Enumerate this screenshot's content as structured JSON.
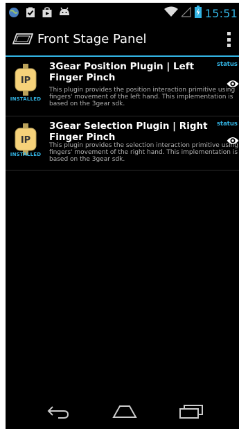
{
  "statusbar": {
    "time": "15:51",
    "icons": [
      "globe-icon",
      "clipboard-check-icon",
      "play-store-icon",
      "android-icon",
      "wifi-icon",
      "signal-icon",
      "battery-charging-icon"
    ]
  },
  "actionbar": {
    "title": "Front Stage Panel"
  },
  "plugins": [
    {
      "title": "3Gear Position Plugin | Left Finger Pinch",
      "badge": "IP",
      "state": "INSTALLED",
      "status": "status",
      "description": "This plugin provides the position interaction primitive using fingers' movement of the left hand. This implementation is based on the 3gear sdk."
    },
    {
      "title": "3Gear Selection Plugin | Right Finger Pinch",
      "badge": "IP",
      "state": "INSTALLED",
      "status": "status",
      "description": "This plugin provides the selection interaction primitive using fingers' movement of the right hand. This implementation is based on the 3gear sdk."
    }
  ],
  "colors": {
    "accent": "#33b5e5",
    "plug_body": "#f6d27a",
    "background": "#000000"
  },
  "navbar": {
    "buttons": [
      "back-icon",
      "home-icon",
      "recents-icon"
    ]
  }
}
